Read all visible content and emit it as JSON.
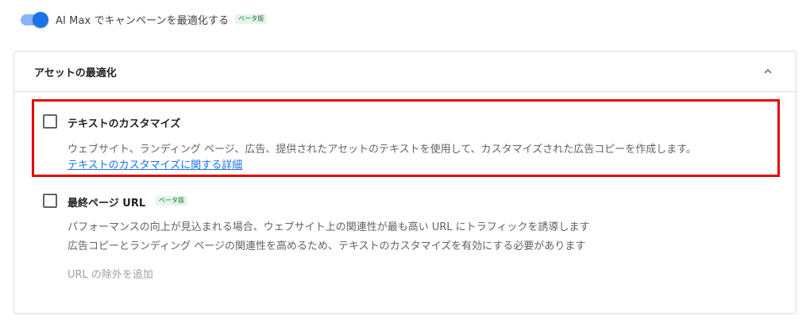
{
  "top": {
    "toggle_label": "AI Max でキャンペーンを最適化する",
    "beta_badge": "ベータ版",
    "toggle_on": true
  },
  "card": {
    "title": "アセットの最適化",
    "collapse_icon": "chevron-up-icon",
    "options": [
      {
        "title": "テキストのカスタマイズ",
        "checked": false,
        "description": "ウェブサイト、ランディング ページ、広告、提供されたアセットのテキストを使用して、カスタマイズされた広告コピーを作成します。",
        "link": "テキストのカスタマイズに関する詳細"
      },
      {
        "title": "最終ページ URL",
        "beta_badge": "ベータ版",
        "checked": false,
        "description_1": "パフォーマンスの向上が見込まれる場合、ウェブサイト上の関連性が最も高い URL にトラフィックを誘導します",
        "description_2": "広告コピーとランディング ページの関連性を高めるため、テキストのカスタマイズを有効にする必要があります",
        "add_exclusion": "URL の除外を追加"
      }
    ]
  },
  "colors": {
    "accent": "#1a73e8",
    "highlight_border": "#e60000",
    "beta_bg": "#e6f4ea",
    "beta_text": "#137333"
  }
}
